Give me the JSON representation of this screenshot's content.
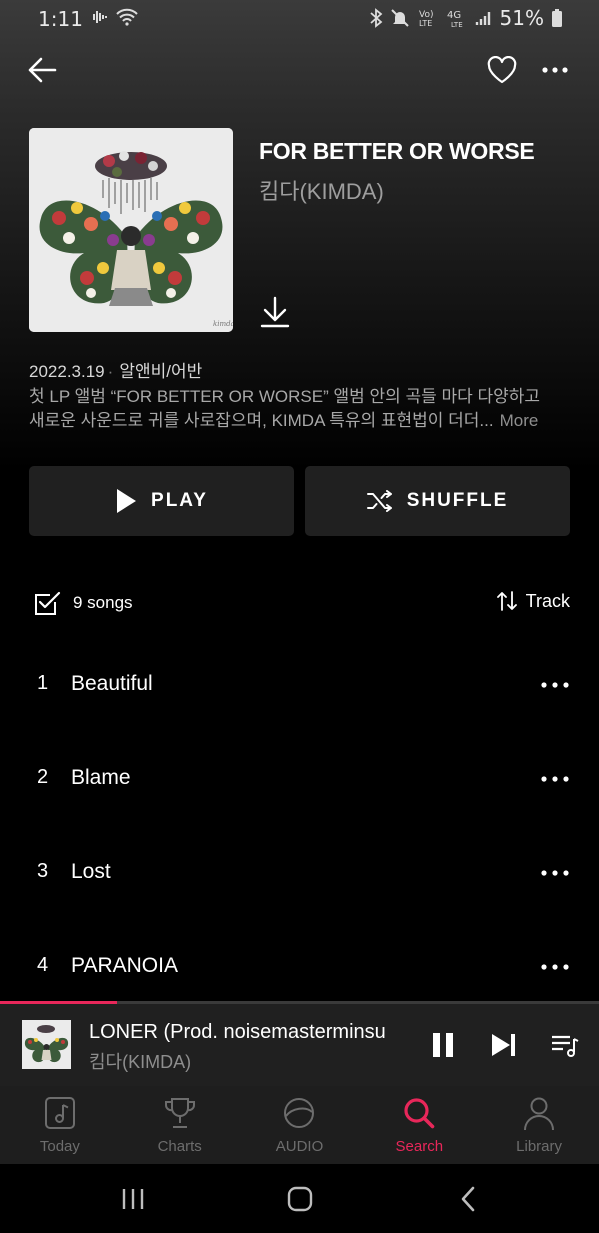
{
  "status_bar": {
    "time": "1:11",
    "battery": "51%"
  },
  "album": {
    "title": "FOR BETTER OR WORSE",
    "artist": "킴다(KIMDA)",
    "release_date": "2022.3.19",
    "genre": "알앤비/어반",
    "description_line1": "첫 LP 앨범 “FOR BETTER OR WORSE” 앨범 안의 곡들 마다 다양하고",
    "description_line2": "새로운 사운드로 귀를 사로잡으며, KIMDA 특유의 표현법이 더더...",
    "more_label": "More"
  },
  "actions": {
    "play_label": "PLAY",
    "shuffle_label": "SHUFFLE"
  },
  "list_header": {
    "song_count": "9 songs",
    "sort_label": "Track"
  },
  "tracks": [
    {
      "num": "1",
      "name": "Beautiful"
    },
    {
      "num": "2",
      "name": "Blame"
    },
    {
      "num": "3",
      "name": "Lost"
    },
    {
      "num": "4",
      "name": "PARANOIA"
    }
  ],
  "now_playing": {
    "title": "LONER (Prod. noisemasterminsu",
    "artist": "킴다(KIMDA)",
    "progress": 0.195
  },
  "bottom_nav": {
    "items": [
      {
        "label": "Today",
        "icon": "music-note-icon"
      },
      {
        "label": "Charts",
        "icon": "trophy-icon"
      },
      {
        "label": "AUDIO",
        "icon": "audio-globe-icon"
      },
      {
        "label": "Search",
        "icon": "search-icon",
        "active": true
      },
      {
        "label": "Library",
        "icon": "person-icon"
      }
    ]
  },
  "colors": {
    "accent": "#e8275a",
    "background": "#000000",
    "button_bg": "#202020"
  }
}
